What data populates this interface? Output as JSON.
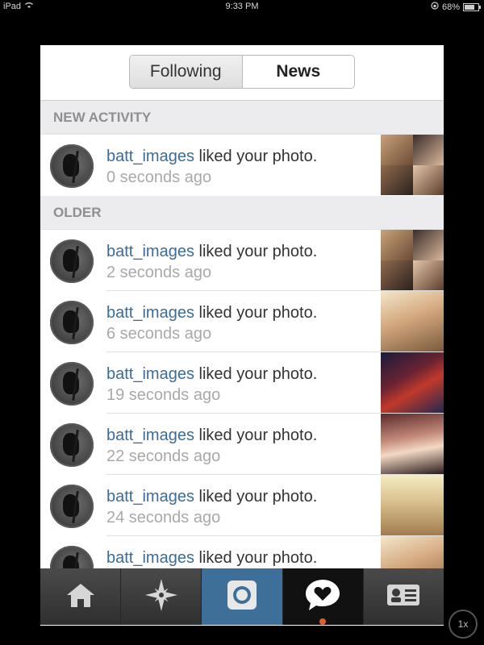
{
  "status_bar": {
    "device": "iPad",
    "time": "9:33 PM",
    "battery": "68%",
    "wifi_icon": "wifi-icon",
    "lock_icon": "rotation-lock-icon"
  },
  "segment": {
    "following": "Following",
    "news": "News"
  },
  "sections": {
    "new_activity": "NEW ACTIVITY",
    "older": "OLDER"
  },
  "new_items": [
    {
      "user": "batt_images",
      "action": " liked your photo.",
      "time": "0 seconds ago"
    }
  ],
  "older_items": [
    {
      "user": "batt_images",
      "action": " liked your photo.",
      "time": "2 seconds ago"
    },
    {
      "user": "batt_images",
      "action": " liked your photo.",
      "time": "6 seconds ago"
    },
    {
      "user": "batt_images",
      "action": " liked your photo.",
      "time": "19 seconds ago"
    },
    {
      "user": "batt_images",
      "action": " liked your photo.",
      "time": "22 seconds ago"
    },
    {
      "user": "batt_images",
      "action": " liked your photo.",
      "time": "24 seconds ago"
    },
    {
      "user": "batt_images",
      "action": " liked your photo.",
      "time": ""
    }
  ],
  "tabs": [
    {
      "name": "home",
      "icon": "home-icon"
    },
    {
      "name": "explore",
      "icon": "compass-icon"
    },
    {
      "name": "camera",
      "icon": "camera-icon"
    },
    {
      "name": "news",
      "icon": "speech-heart-icon"
    },
    {
      "name": "profile",
      "icon": "profile-card-icon"
    }
  ],
  "zoom_label": "1x",
  "colors": {
    "username": "#3b6c99",
    "camera_tab": "#3e6f99",
    "notification_dot": "#e35d2b"
  }
}
